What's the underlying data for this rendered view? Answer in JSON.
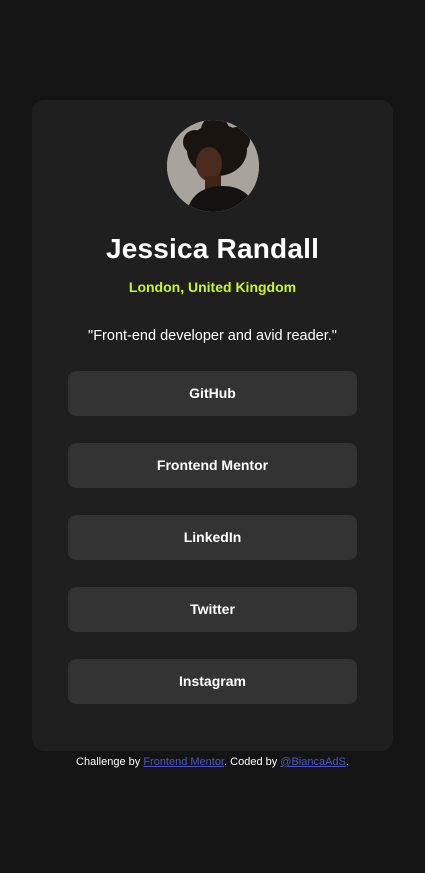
{
  "profile": {
    "name": "Jessica Randall",
    "location": "London, United Kingdom",
    "bio": "\"Front-end developer and avid reader.\""
  },
  "links": [
    {
      "label": "GitHub"
    },
    {
      "label": "Frontend Mentor"
    },
    {
      "label": "LinkedIn"
    },
    {
      "label": "Twitter"
    },
    {
      "label": "Instagram"
    }
  ],
  "footer": {
    "prefix": "Challenge by ",
    "challenge_link": "Frontend Mentor",
    "middle": ". Coded by ",
    "author_link": "@BiancaAdS",
    "suffix": "."
  },
  "colors": {
    "page_background": "#141414",
    "card_background": "#1f1f1f",
    "button_background": "#333333",
    "accent": "#c4f82a",
    "footer_link": "#4a56c9"
  }
}
